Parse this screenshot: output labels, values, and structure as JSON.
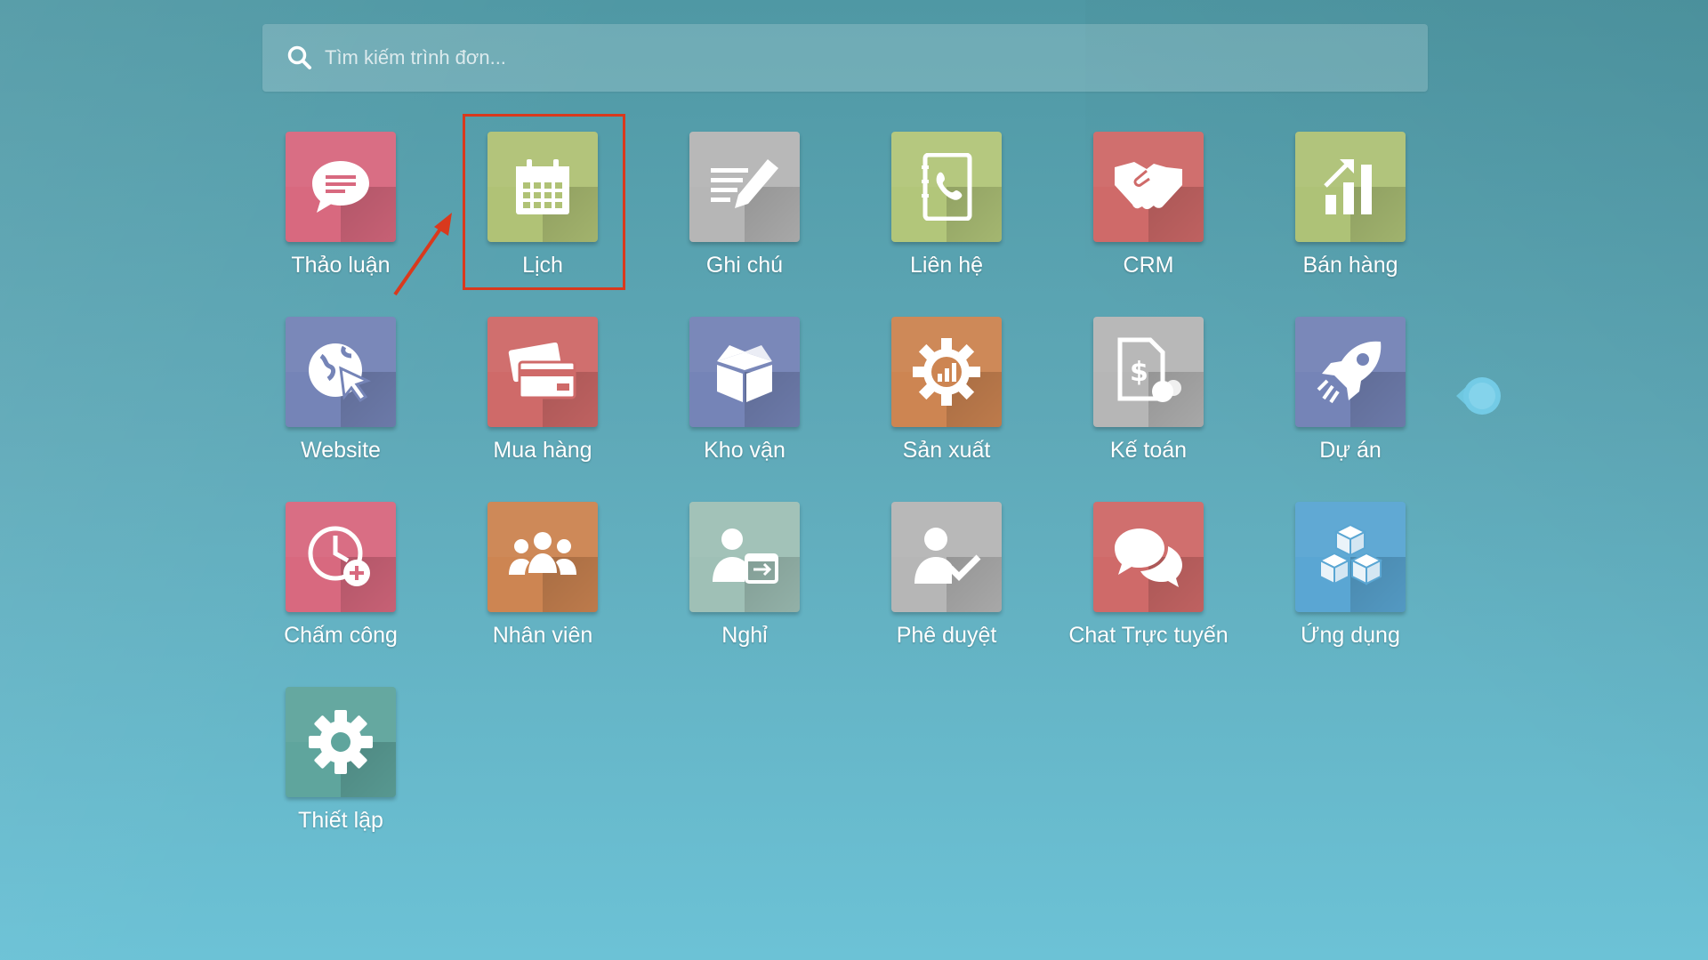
{
  "search": {
    "placeholder": "Tìm kiếm trình đơn...",
    "value": ""
  },
  "apps": [
    {
      "id": "thao-luan",
      "label": "Thảo luận",
      "icon": "chat-bubble-icon",
      "color": "#d8697f"
    },
    {
      "id": "lich",
      "label": "Lịch",
      "icon": "calendar-icon",
      "color": "#b0c276"
    },
    {
      "id": "ghi-chu",
      "label": "Ghi chú",
      "icon": "note-pencil-icon",
      "color": "#b6b6b6"
    },
    {
      "id": "lien-he",
      "label": "Liên hệ",
      "icon": "contact-book-icon",
      "color": "#b2c67a"
    },
    {
      "id": "crm",
      "label": "CRM",
      "icon": "handshake-icon",
      "color": "#cf6a69"
    },
    {
      "id": "ban-hang",
      "label": "Bán hàng",
      "icon": "sales-chart-icon",
      "color": "#aec277"
    },
    {
      "id": "website",
      "label": "Website",
      "icon": "globe-cursor-icon",
      "color": "#7584b7"
    },
    {
      "id": "mua-hang",
      "label": "Mua hàng",
      "icon": "credit-cards-icon",
      "color": "#cf6a69"
    },
    {
      "id": "kho-van",
      "label": "Kho vận",
      "icon": "box-icon",
      "color": "#7584b7"
    },
    {
      "id": "san-xuat",
      "label": "Sản xuất",
      "icon": "gear-chart-icon",
      "color": "#cd8552"
    },
    {
      "id": "ke-toan",
      "label": "Kế toán",
      "icon": "invoice-dollar-icon",
      "color": "#b6b6b6"
    },
    {
      "id": "du-an",
      "label": "Dự án",
      "icon": "rocket-icon",
      "color": "#7584b7"
    },
    {
      "id": "cham-cong",
      "label": "Chấm công",
      "icon": "clock-plus-icon",
      "color": "#d8697f"
    },
    {
      "id": "nhan-vien",
      "label": "Nhân viên",
      "icon": "people-group-icon",
      "color": "#cd8552"
    },
    {
      "id": "nghi",
      "label": "Nghỉ",
      "icon": "person-calendar-icon",
      "color": "#9fc0b6"
    },
    {
      "id": "phe-duyet",
      "label": "Phê duyệt",
      "icon": "person-check-icon",
      "color": "#b6b6b6"
    },
    {
      "id": "chat-truc-tuyen",
      "label": "Chat Trực tuyến",
      "icon": "chat-bubbles-icon",
      "color": "#cf6a69"
    },
    {
      "id": "ung-dung",
      "label": "Ứng dụng",
      "icon": "cubes-icon",
      "color": "#5aa6d3"
    },
    {
      "id": "thiet-lap",
      "label": "Thiết lập",
      "icon": "gear-icon",
      "color": "#5fa59d"
    }
  ]
}
